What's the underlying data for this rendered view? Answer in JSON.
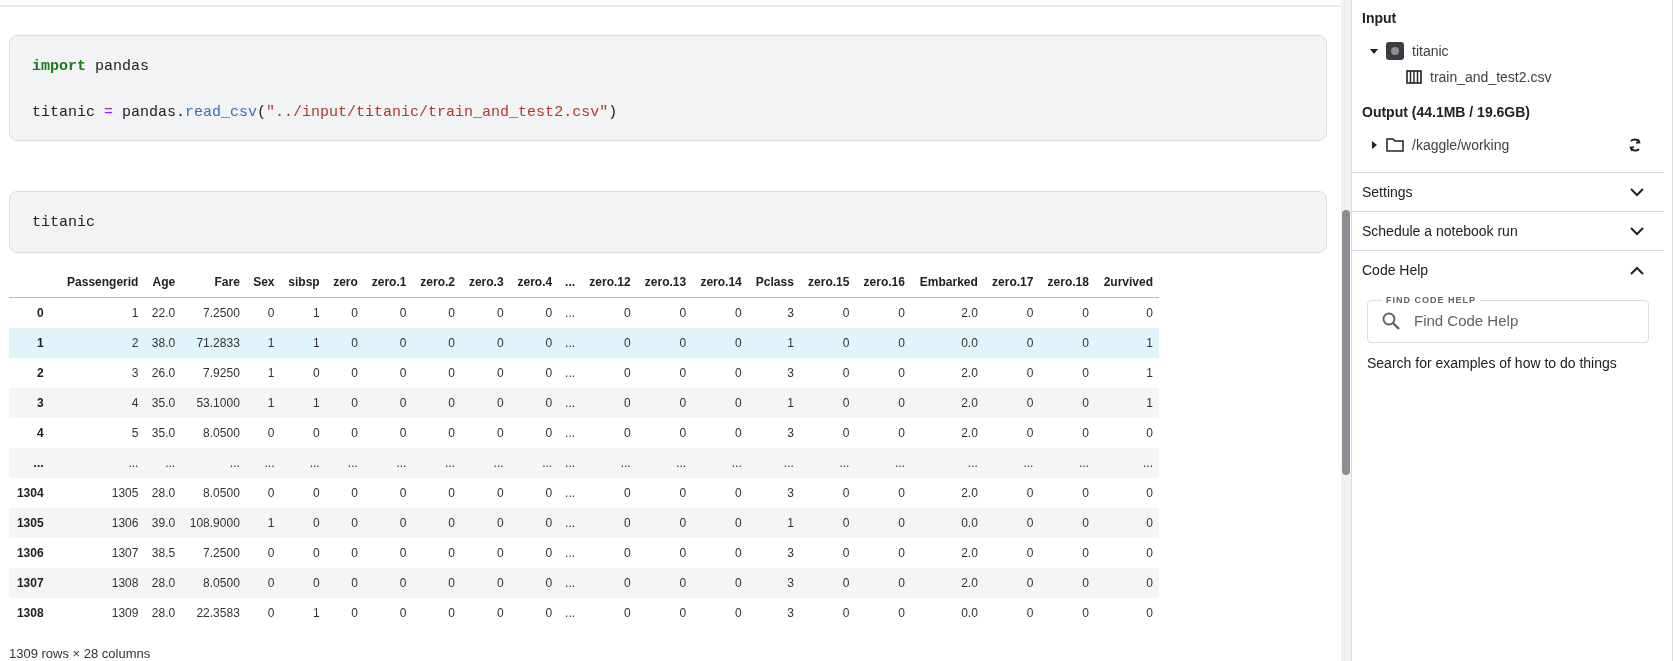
{
  "cells": [
    {
      "lines": [
        [
          {
            "kind": "keyword",
            "text": "import"
          },
          {
            "kind": "plain",
            "text": " pandas"
          }
        ],
        [
          {
            "kind": "plain",
            "text": "titanic "
          },
          {
            "kind": "operator",
            "text": "="
          },
          {
            "kind": "plain",
            "text": " pandas."
          },
          {
            "kind": "function",
            "text": "read_csv"
          },
          {
            "kind": "plain",
            "text": "("
          },
          {
            "kind": "string",
            "text": "\"../input/titanic/train_and_test2.csv\""
          },
          {
            "kind": "plain",
            "text": ")"
          }
        ]
      ]
    },
    {
      "lines": [
        [
          {
            "kind": "plain",
            "text": "titanic"
          }
        ]
      ]
    }
  ],
  "table": {
    "columns": [
      "Passengerid",
      "Age",
      "Fare",
      "Sex",
      "sibsp",
      "zero",
      "zero.1",
      "zero.2",
      "zero.3",
      "zero.4",
      "...",
      "zero.12",
      "zero.13",
      "zero.14",
      "Pclass",
      "zero.15",
      "zero.16",
      "Embarked",
      "zero.17",
      "zero.18",
      "2urvived"
    ],
    "rows": [
      {
        "index": "0",
        "highlighted": false,
        "cells": [
          "1",
          "22.0",
          "7.2500",
          "0",
          "1",
          "0",
          "0",
          "0",
          "0",
          "0",
          "...",
          "0",
          "0",
          "0",
          "3",
          "0",
          "0",
          "2.0",
          "0",
          "0",
          "0"
        ]
      },
      {
        "index": "1",
        "highlighted": true,
        "cells": [
          "2",
          "38.0",
          "71.2833",
          "1",
          "1",
          "0",
          "0",
          "0",
          "0",
          "0",
          "...",
          "0",
          "0",
          "0",
          "1",
          "0",
          "0",
          "0.0",
          "0",
          "0",
          "1"
        ]
      },
      {
        "index": "2",
        "highlighted": false,
        "cells": [
          "3",
          "26.0",
          "7.9250",
          "1",
          "0",
          "0",
          "0",
          "0",
          "0",
          "0",
          "...",
          "0",
          "0",
          "0",
          "3",
          "0",
          "0",
          "2.0",
          "0",
          "0",
          "1"
        ]
      },
      {
        "index": "3",
        "highlighted": false,
        "cells": [
          "4",
          "35.0",
          "53.1000",
          "1",
          "1",
          "0",
          "0",
          "0",
          "0",
          "0",
          "...",
          "0",
          "0",
          "0",
          "1",
          "0",
          "0",
          "2.0",
          "0",
          "0",
          "1"
        ]
      },
      {
        "index": "4",
        "highlighted": false,
        "cells": [
          "5",
          "35.0",
          "8.0500",
          "0",
          "0",
          "0",
          "0",
          "0",
          "0",
          "0",
          "...",
          "0",
          "0",
          "0",
          "3",
          "0",
          "0",
          "2.0",
          "0",
          "0",
          "0"
        ]
      },
      {
        "index": "...",
        "highlighted": false,
        "cells": [
          "...",
          "...",
          "...",
          "...",
          "...",
          "...",
          "...",
          "...",
          "...",
          "...",
          "...",
          "...",
          "...",
          "...",
          "...",
          "...",
          "...",
          "...",
          "...",
          "...",
          "..."
        ]
      },
      {
        "index": "1304",
        "highlighted": false,
        "cells": [
          "1305",
          "28.0",
          "8.0500",
          "0",
          "0",
          "0",
          "0",
          "0",
          "0",
          "0",
          "...",
          "0",
          "0",
          "0",
          "3",
          "0",
          "0",
          "2.0",
          "0",
          "0",
          "0"
        ]
      },
      {
        "index": "1305",
        "highlighted": false,
        "cells": [
          "1306",
          "39.0",
          "108.9000",
          "1",
          "0",
          "0",
          "0",
          "0",
          "0",
          "0",
          "...",
          "0",
          "0",
          "0",
          "1",
          "0",
          "0",
          "0.0",
          "0",
          "0",
          "0"
        ]
      },
      {
        "index": "1306",
        "highlighted": false,
        "cells": [
          "1307",
          "38.5",
          "7.2500",
          "0",
          "0",
          "0",
          "0",
          "0",
          "0",
          "0",
          "...",
          "0",
          "0",
          "0",
          "3",
          "0",
          "0",
          "2.0",
          "0",
          "0",
          "0"
        ]
      },
      {
        "index": "1307",
        "highlighted": false,
        "cells": [
          "1308",
          "28.0",
          "8.0500",
          "0",
          "0",
          "0",
          "0",
          "0",
          "0",
          "0",
          "...",
          "0",
          "0",
          "0",
          "3",
          "0",
          "0",
          "2.0",
          "0",
          "0",
          "0"
        ]
      },
      {
        "index": "1308",
        "highlighted": false,
        "cells": [
          "1309",
          "28.0",
          "22.3583",
          "0",
          "1",
          "0",
          "0",
          "0",
          "0",
          "0",
          "...",
          "0",
          "0",
          "0",
          "3",
          "0",
          "0",
          "0.0",
          "0",
          "0",
          "0"
        ]
      }
    ],
    "summary": "1309 rows × 28 columns"
  },
  "sidebar": {
    "input": {
      "heading": "Input",
      "tree": [
        {
          "label": "titanic",
          "kind": "dataset",
          "expanded": true,
          "children": [
            {
              "label": "train_and_test2.csv",
              "kind": "table"
            }
          ]
        }
      ]
    },
    "output": {
      "heading": "Output (44.1MB / 19.6GB)",
      "tree": [
        {
          "label": "/kaggle/working",
          "kind": "folder",
          "expanded": false
        }
      ]
    },
    "sections": [
      {
        "title": "Settings",
        "expanded": false
      },
      {
        "title": "Schedule a notebook run",
        "expanded": false
      },
      {
        "title": "Code Help",
        "expanded": true,
        "field_label": "FIND CODE HELP",
        "placeholder": "Find Code Help",
        "hint": "Search for examples of how to do things"
      }
    ]
  }
}
